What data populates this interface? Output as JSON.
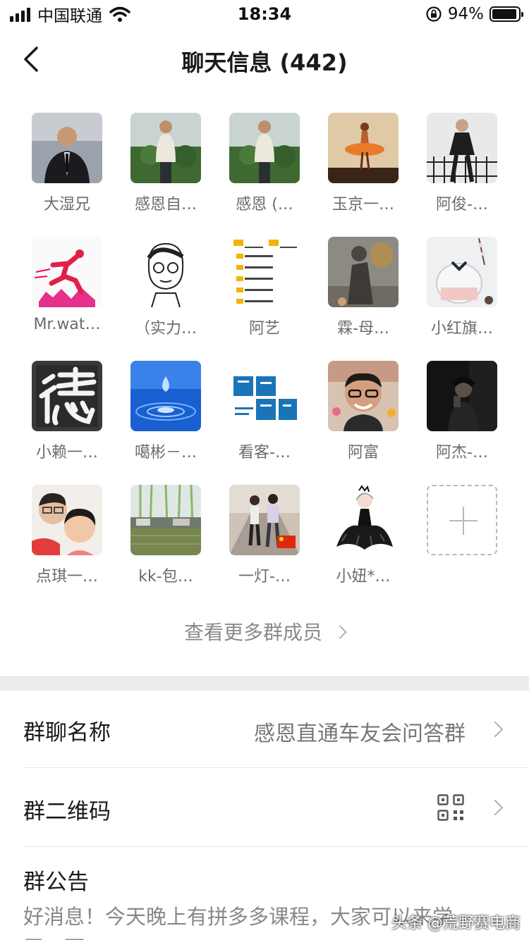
{
  "status_bar": {
    "carrier": "中国联通",
    "time": "18:34",
    "battery_percent": "94%",
    "battery_level": 0.94
  },
  "nav": {
    "title": "聊天信息 (442)",
    "back_icon": "chevron-left-icon"
  },
  "members": [
    {
      "name": "大湿兄",
      "avatar": "photo-man-in-suit"
    },
    {
      "name": "感恩自…",
      "avatar": "photo-man-in-field"
    },
    {
      "name": "感恩 (…",
      "avatar": "photo-man-in-field"
    },
    {
      "name": "玉京一…",
      "avatar": "photo-ballerina"
    },
    {
      "name": "阿俊-…",
      "avatar": "photo-man-on-balcony"
    },
    {
      "name": "Mr.wat…",
      "avatar": "illustration-runner"
    },
    {
      "name": "（实力…",
      "avatar": "sketch-glasses-cheers"
    },
    {
      "name": "阿艺",
      "avatar": "logo-studio-list"
    },
    {
      "name": "霖-母…",
      "avatar": "photo-statue"
    },
    {
      "name": "小红旗…",
      "avatar": "photo-gift-basket"
    },
    {
      "name": "小赖一…",
      "avatar": "calligraphy-de"
    },
    {
      "name": "噶彬－…",
      "avatar": "photo-water-drop"
    },
    {
      "name": "看客-…",
      "avatar": "text-thanks"
    },
    {
      "name": "阿富",
      "avatar": "photo-smiling-man"
    },
    {
      "name": "阿杰-…",
      "avatar": "photo-dark-selfie"
    },
    {
      "name": "点琪一…",
      "avatar": "photo-father-child"
    },
    {
      "name": "kk-包…",
      "avatar": "photo-willow-pond"
    },
    {
      "name": "一灯-…",
      "avatar": "photo-couple-street"
    },
    {
      "name": "小妞*…",
      "avatar": "illustration-dancer"
    }
  ],
  "add_member_icon": "plus-icon",
  "more_members_label": "查看更多群成员",
  "settings": {
    "group_name_label": "群聊名称",
    "group_name_value": "感恩直通车友会问答群",
    "qr_label": "群二维码",
    "notice_label": "群公告",
    "notice_text": "好消息！今天晚上有拼多多课程，大家可以来学",
    "notice_text_line2": "习一下"
  },
  "watermark": "头条 @荒野赛电商"
}
